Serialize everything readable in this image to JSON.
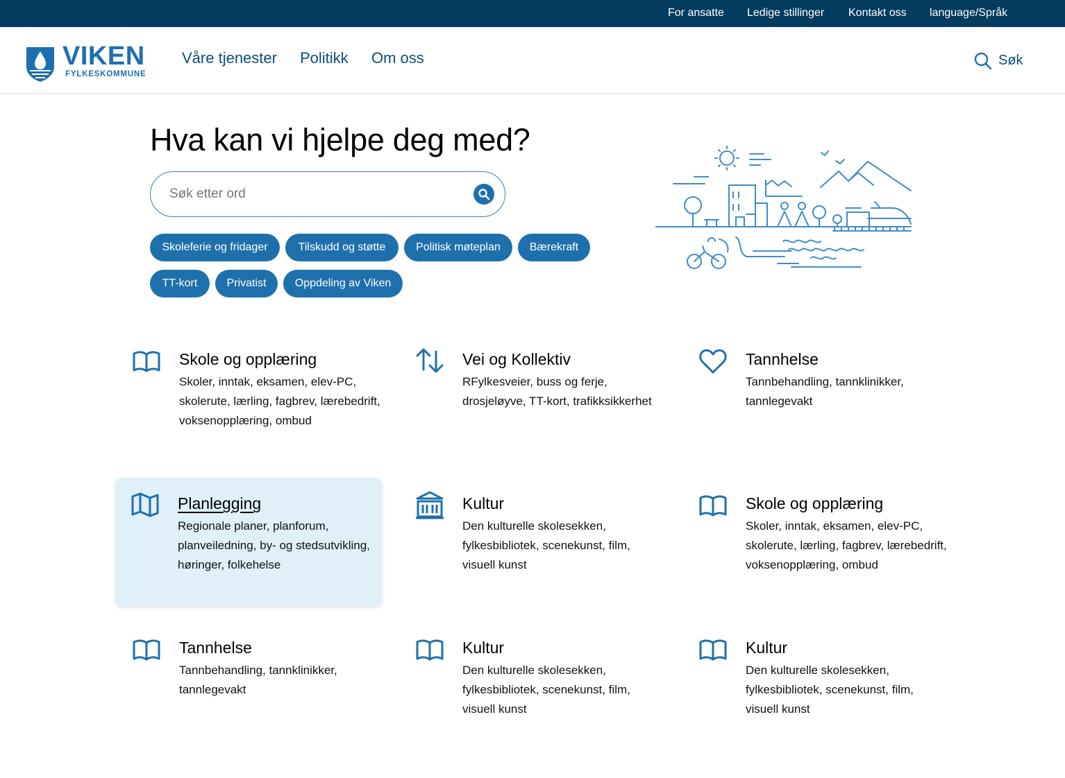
{
  "topbar": {
    "links": [
      "For ansatte",
      "Ledige stillinger",
      "Kontakt oss",
      "language/Språk"
    ]
  },
  "header": {
    "logo_name": "VIKEN",
    "logo_sub": "FYLKESKOMMUNE",
    "nav": [
      "Våre tjenester",
      "Politikk",
      "Om oss"
    ],
    "search_label": "Søk",
    "colors": {
      "topbar": "#043c5f",
      "brand": "#1e6fae"
    }
  },
  "hero": {
    "title": "Hva kan vi hjelpe deg med?",
    "search_placeholder": "Søk etter ord",
    "search_icon": "search-icon",
    "quicklinks": [
      "Skoleferie og fridager",
      "Tilskudd og støtte",
      "Politisk møteplan",
      "Bærekraft",
      "TT-kort",
      "Privatist",
      "Oppdeling av Viken"
    ]
  },
  "cards": [
    {
      "title": "Skole og opplæring",
      "desc": "Skoler, inntak, eksamen, elev-PC, skolerute, lærling, fagbrev, lærebedrift, voksenopplæring, ombud",
      "icon": "book-icon"
    },
    {
      "title": "Vei og Kollektiv",
      "desc": "RFylkesveier, buss og ferje, drosjeløyve, TT-kort, trafikksikkerhet",
      "icon": "arrows-updown-icon"
    },
    {
      "title": "Tannhelse",
      "desc": "Tannbehandling, tannklinikker, tannlegevakt",
      "icon": "heart-icon"
    },
    {
      "title": "Planlegging",
      "desc": "Regionale planer, planforum, planveiledning, by- og stedsutvikling, høringer, folkehelse",
      "icon": "map-icon"
    },
    {
      "title": "Kultur",
      "desc": "Den kulturelle skolesekken, fylkesbibliotek, scenekunst, film, visuell kunst",
      "icon": "museum-icon"
    },
    {
      "title": "Skole og opplæring",
      "desc": "Skoler, inntak, eksamen, elev-PC, skolerute, lærling, fagbrev, lærebedrift, voksenopplæring, ombud",
      "icon": "book-icon"
    },
    {
      "title": "Tannhelse",
      "desc": "Tannbehandling, tannklinikker, tannlegevakt",
      "icon": "book-icon"
    },
    {
      "title": "Kultur",
      "desc": "Den kulturelle skolesekken, fylkesbibliotek, scenekunst, film, visuell kunst",
      "icon": "book-icon"
    },
    {
      "title": "Kultur",
      "desc": "Den kulturelle skolesekken, fylkesbibliotek, scenekunst, film, visuell kunst",
      "icon": "book-icon"
    }
  ]
}
